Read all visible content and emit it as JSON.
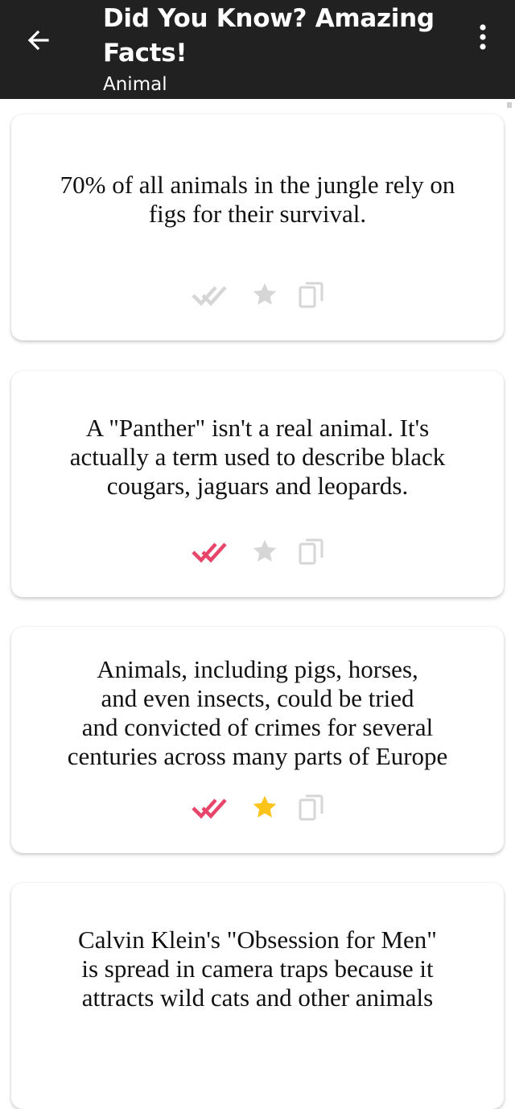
{
  "header": {
    "title": "Did You Know? Amazing Facts!",
    "subtitle": "Animal",
    "back_icon": "arrow-left-icon",
    "menu_icon": "more-vertical-icon"
  },
  "colors": {
    "app_bar": "#212121",
    "read_active": "#e8456a",
    "inactive": "#d6d6d6",
    "star_active": "#fcc419"
  },
  "facts": [
    {
      "text": "70% of all animals in the jungle rely on\nfigs for their survival.",
      "read": false,
      "favorite": false
    },
    {
      "text": "A \"Panther\" isn't a real animal. It's\nactually a term used to describe black\ncougars, jaguars and leopards.",
      "read": true,
      "favorite": false
    },
    {
      "text": "Animals, including pigs, horses,\nand even insects, could be tried\nand convicted of crimes for several\ncenturies across many parts of Europe",
      "read": true,
      "favorite": true
    },
    {
      "text": "Calvin Klein's \"Obsession for Men\"\nis spread in camera traps because it\nattracts wild cats and other animals",
      "read": false,
      "favorite": false
    }
  ]
}
